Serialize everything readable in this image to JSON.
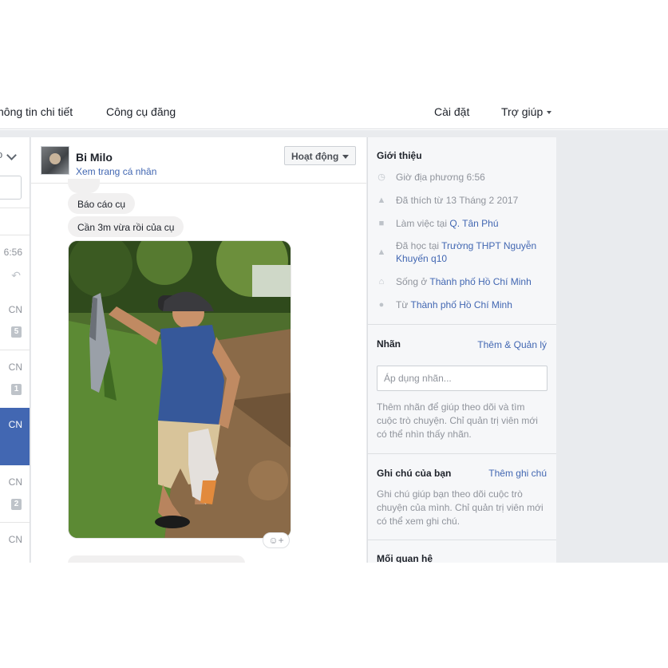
{
  "topnav": {
    "details_tab": "hông tin chi tiết",
    "publishing_tools": "Công cụ đăng",
    "settings": "Cài đặt",
    "help": "Trợ giúp"
  },
  "thread_list": {
    "filter_partial": "o",
    "rows": [
      {
        "date": "6:56",
        "badge": ""
      },
      {
        "date": "CN",
        "badge": "5"
      },
      {
        "date": "CN",
        "badge": "1"
      },
      {
        "date": "CN",
        "badge": ""
      },
      {
        "date": "CN",
        "badge": "2"
      },
      {
        "date": "CN",
        "badge": ""
      }
    ]
  },
  "conversation": {
    "contact_name": "Bi Milo",
    "profile_link": "Xem trang cá nhân",
    "activity_button": "Hoạt động",
    "messages": [
      "Báo cáo cụ",
      "Cần 3m vừa rồi của cụ"
    ],
    "reaction_icon": "smiley-plus-icon"
  },
  "info": {
    "intro_title": "Giới thiệu",
    "local_time": "Giờ địa phương 6:56",
    "liked_since": "Đã thích từ 13 Tháng 2 2017",
    "works_at_prefix": "Làm việc tại ",
    "works_at_link": "Q. Tân Phú",
    "studied_prefix": "Đã học tại ",
    "studied_link": "Trường THPT Nguyễn Khuyến q10",
    "lives_prefix": "Sống ở ",
    "lives_link": "Thành phố Hồ Chí Minh",
    "from_prefix": "Từ ",
    "from_link": "Thành phố Hồ Chí Minh",
    "labels_title": "Nhãn",
    "labels_action": "Thêm & Quản lý",
    "labels_placeholder": "Áp dụng nhãn...",
    "labels_help": "Thêm nhãn để giúp theo dõi và tìm cuộc trò chuyện. Chỉ quản trị viên mới có thể nhìn thấy nhãn.",
    "notes_title": "Ghi chú của bạn",
    "notes_action": "Thêm ghi chú",
    "notes_help": "Ghi chú giúp bạn theo dõi cuộc trò chuyện của mình. Chỉ quản trị viên mới có thể xem ghi chú.",
    "relationship_title": "Mối quan hệ"
  }
}
